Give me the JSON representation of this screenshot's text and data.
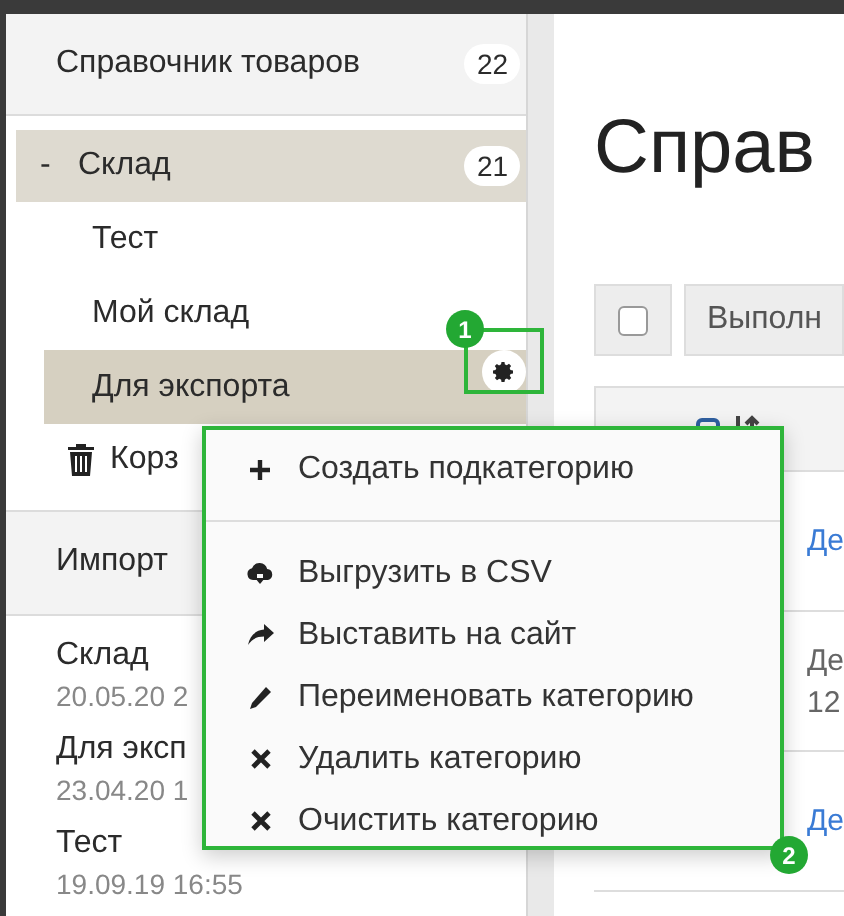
{
  "sidebar": {
    "catalog": {
      "label": "Справочник товаров",
      "count": "22"
    },
    "tree": [
      {
        "toggle": "-",
        "label": "Склад",
        "count": "21",
        "expanded": true,
        "selected": false,
        "children": [
          {
            "label": "Тест",
            "selected": false
          },
          {
            "label": "Мой склад",
            "selected": false
          },
          {
            "label": "Для экспорта",
            "selected": true
          }
        ]
      }
    ],
    "trash": {
      "label": "Корз"
    },
    "imports": {
      "title": "Импорт",
      "items": [
        {
          "name": "Склад",
          "date": "20.05.20 2"
        },
        {
          "name": "Для эксп",
          "date": "23.04.20 1"
        },
        {
          "name": "Тест",
          "date": "19.09.19 16:55"
        }
      ]
    }
  },
  "main": {
    "title": "Справ",
    "toolbar": {
      "checked": false,
      "action": "Выполн"
    },
    "rows": [
      {
        "kind": "link",
        "lines": [
          "Де"
        ]
      },
      {
        "kind": "text",
        "lines": [
          "Де",
          "12"
        ]
      },
      {
        "kind": "link",
        "lines": [
          "Де"
        ]
      }
    ]
  },
  "context_menu": {
    "groups": [
      [
        {
          "kind": "plus",
          "label": "Создать подкатегорию"
        }
      ],
      [
        {
          "kind": "cloud",
          "label": "Выгрузить в CSV"
        },
        {
          "kind": "share",
          "label": "Выставить на сайт"
        },
        {
          "kind": "pencil",
          "label": "Переименовать категорию"
        },
        {
          "kind": "cross",
          "label": "Удалить категорию"
        },
        {
          "kind": "cross",
          "label": "Очистить категорию"
        }
      ]
    ]
  },
  "callouts": [
    {
      "label": "1"
    },
    {
      "label": "2"
    }
  ]
}
